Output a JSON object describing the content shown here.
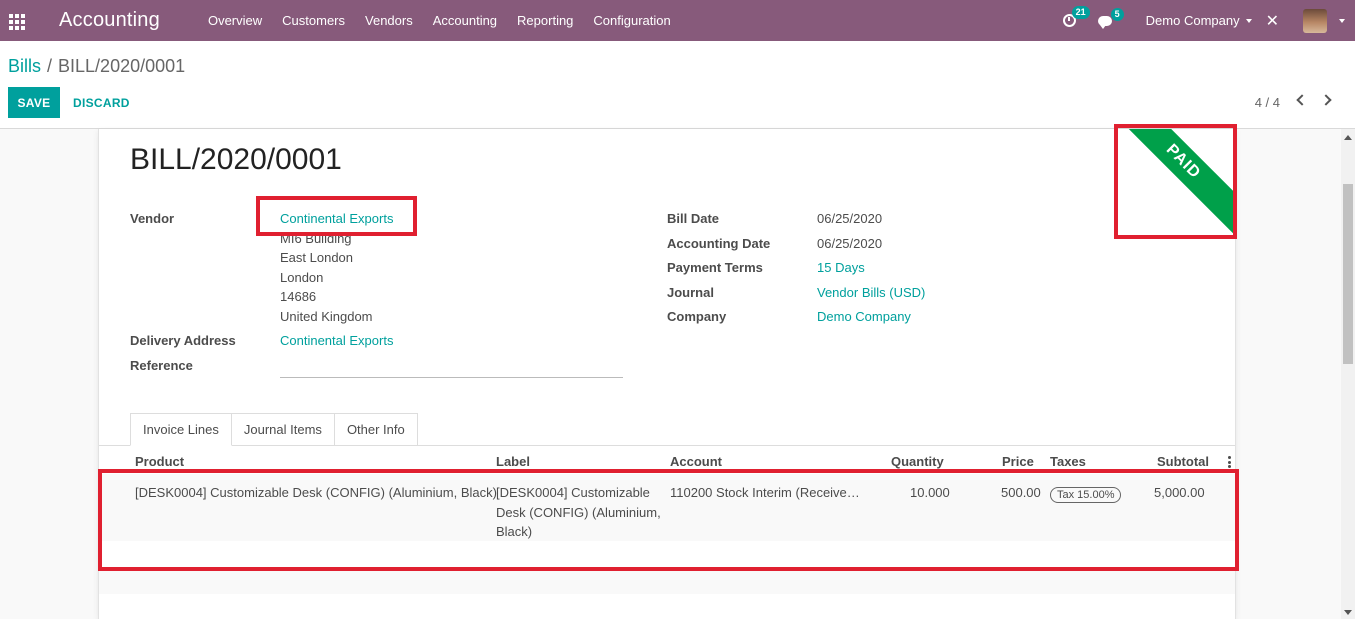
{
  "navbar": {
    "brand": "Accounting",
    "menu": [
      "Overview",
      "Customers",
      "Vendors",
      "Accounting",
      "Reporting",
      "Configuration"
    ],
    "activities_count": "21",
    "messages_count": "5",
    "company": "Demo Company",
    "tools_glyph": "✕"
  },
  "breadcrumb": {
    "parent": "Bills",
    "separator": "/",
    "current": "BILL/2020/0001"
  },
  "buttons": {
    "save": "SAVE",
    "discard": "DISCARD"
  },
  "pager": {
    "value": "4 / 4"
  },
  "bill": {
    "title": "BILL/2020/0001",
    "status_ribbon": "PAID",
    "vendor_label": "Vendor",
    "vendor": "Continental Exports",
    "address": [
      "MI6 Building",
      "East London",
      "London",
      "14686",
      "United Kingdom"
    ],
    "delivery_label": "Delivery Address",
    "delivery": "Continental Exports",
    "reference_label": "Reference",
    "bill_date_label": "Bill Date",
    "bill_date": "06/25/2020",
    "accounting_date_label": "Accounting Date",
    "accounting_date": "06/25/2020",
    "payment_terms_label": "Payment Terms",
    "payment_terms": "15 Days",
    "journal_label": "Journal",
    "journal": "Vendor Bills (USD)",
    "company_label": "Company",
    "company": "Demo Company"
  },
  "tabs": [
    "Invoice Lines",
    "Journal Items",
    "Other Info"
  ],
  "table": {
    "headers": {
      "product": "Product",
      "label": "Label",
      "account": "Account",
      "quantity": "Quantity",
      "price": "Price",
      "taxes": "Taxes",
      "subtotal": "Subtotal"
    },
    "row": {
      "product": "[DESK0004] Customizable Desk (CONFIG) (Aluminium, Black)",
      "label_lines": [
        "[DESK0004] Customizable",
        "Desk (CONFIG) (Aluminium,",
        "Black)"
      ],
      "account": "110200 Stock Interim (Receive…",
      "quantity": "10.000",
      "price": "500.00",
      "tax": "Tax 15.00%",
      "subtotal": "5,000.00"
    }
  },
  "colors": {
    "brand": "#875a7b",
    "accent": "#00a09d",
    "ribbon": "#00a04a",
    "highlight": "#e02030"
  }
}
